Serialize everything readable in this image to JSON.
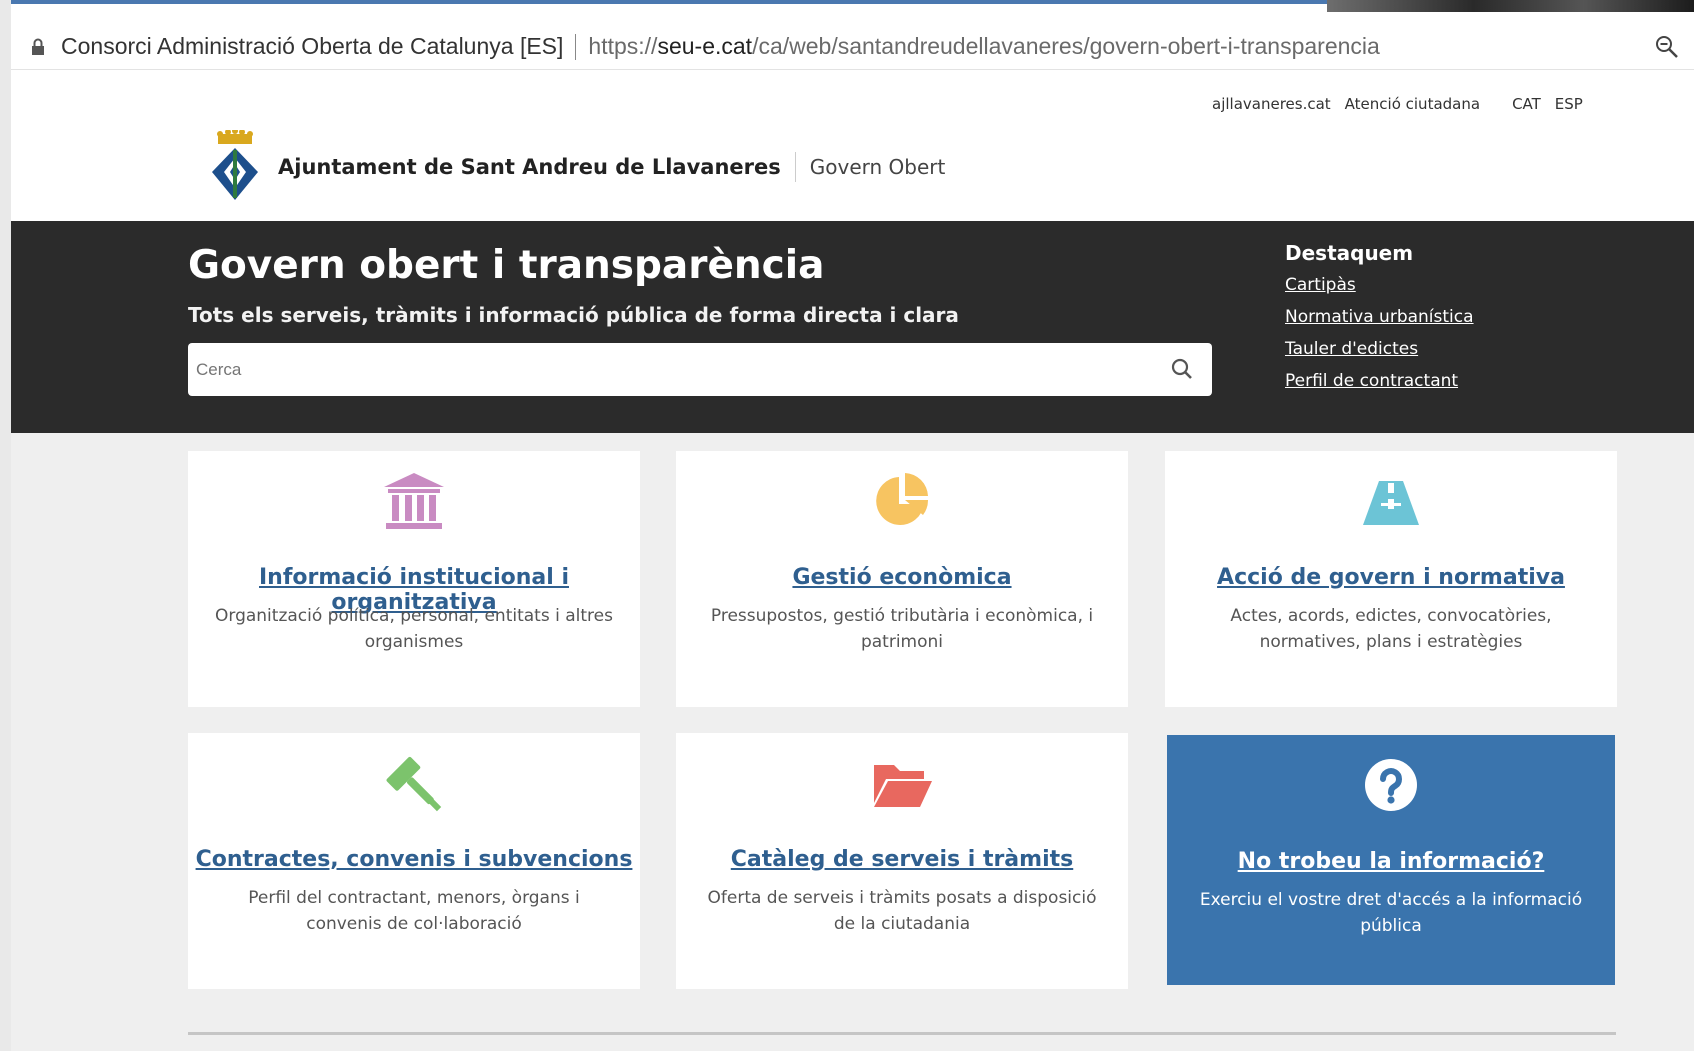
{
  "browser": {
    "site_name": "Consorci Administració Oberta de Catalunya [ES]",
    "url_prefix": "https://",
    "url_domain": "seu-e.cat",
    "url_path": "/ca/web/santandreudellavaneres/govern-obert-i-transparencia"
  },
  "toplinks": {
    "site": "ajllavaneres.cat",
    "attention": "Atenció ciutadana",
    "lang_cat": "CAT",
    "lang_esp": "ESP"
  },
  "brand": {
    "name": "Ajuntament de Sant Andreu de Llavaneres",
    "subtitle": "Govern Obert"
  },
  "hero": {
    "title": "Govern obert i transparència",
    "tagline": "Tots els serveis, tràmits i informació pública de forma directa i clara",
    "search_placeholder": "Cerca"
  },
  "highlights": {
    "title": "Destaquem",
    "links": [
      "Cartipàs",
      "Normativa urbanística",
      "Tauler d'edictes",
      "Perfil de contractant"
    ]
  },
  "cards": [
    {
      "title": "Informació institucional i organitzativa",
      "desc": "Organització política, personal, entitats i altres organismes",
      "icon": "institution-icon",
      "color": "#c98bc2"
    },
    {
      "title": "Gestió econòmica",
      "desc": "Pressupostos, gestió tributària i econòmica, i patrimoni",
      "icon": "pie-chart-icon",
      "color": "#f7c461"
    },
    {
      "title": "Acció de govern i normativa",
      "desc": "Actes, acords, edictes, convocatòries, normatives, plans i estratègies",
      "icon": "road-icon",
      "color": "#6cc4d6"
    },
    {
      "title": "Contractes, convenis i subvencions",
      "desc": "Perfil del contractant, menors, òrgans i convenis de col·laboració",
      "icon": "gavel-icon",
      "color": "#7cc36c"
    },
    {
      "title": "Catàleg de serveis i tràmits",
      "desc": "Oferta de serveis i tràmits posats a disposició de la ciutadania",
      "icon": "folder-open-icon",
      "color": "#e8685f"
    },
    {
      "title": "No trobeu la informació?",
      "desc": "Exerciu el vostre dret d'accés a la informació pública",
      "icon": "question-icon",
      "color": "#3a74ad"
    }
  ]
}
